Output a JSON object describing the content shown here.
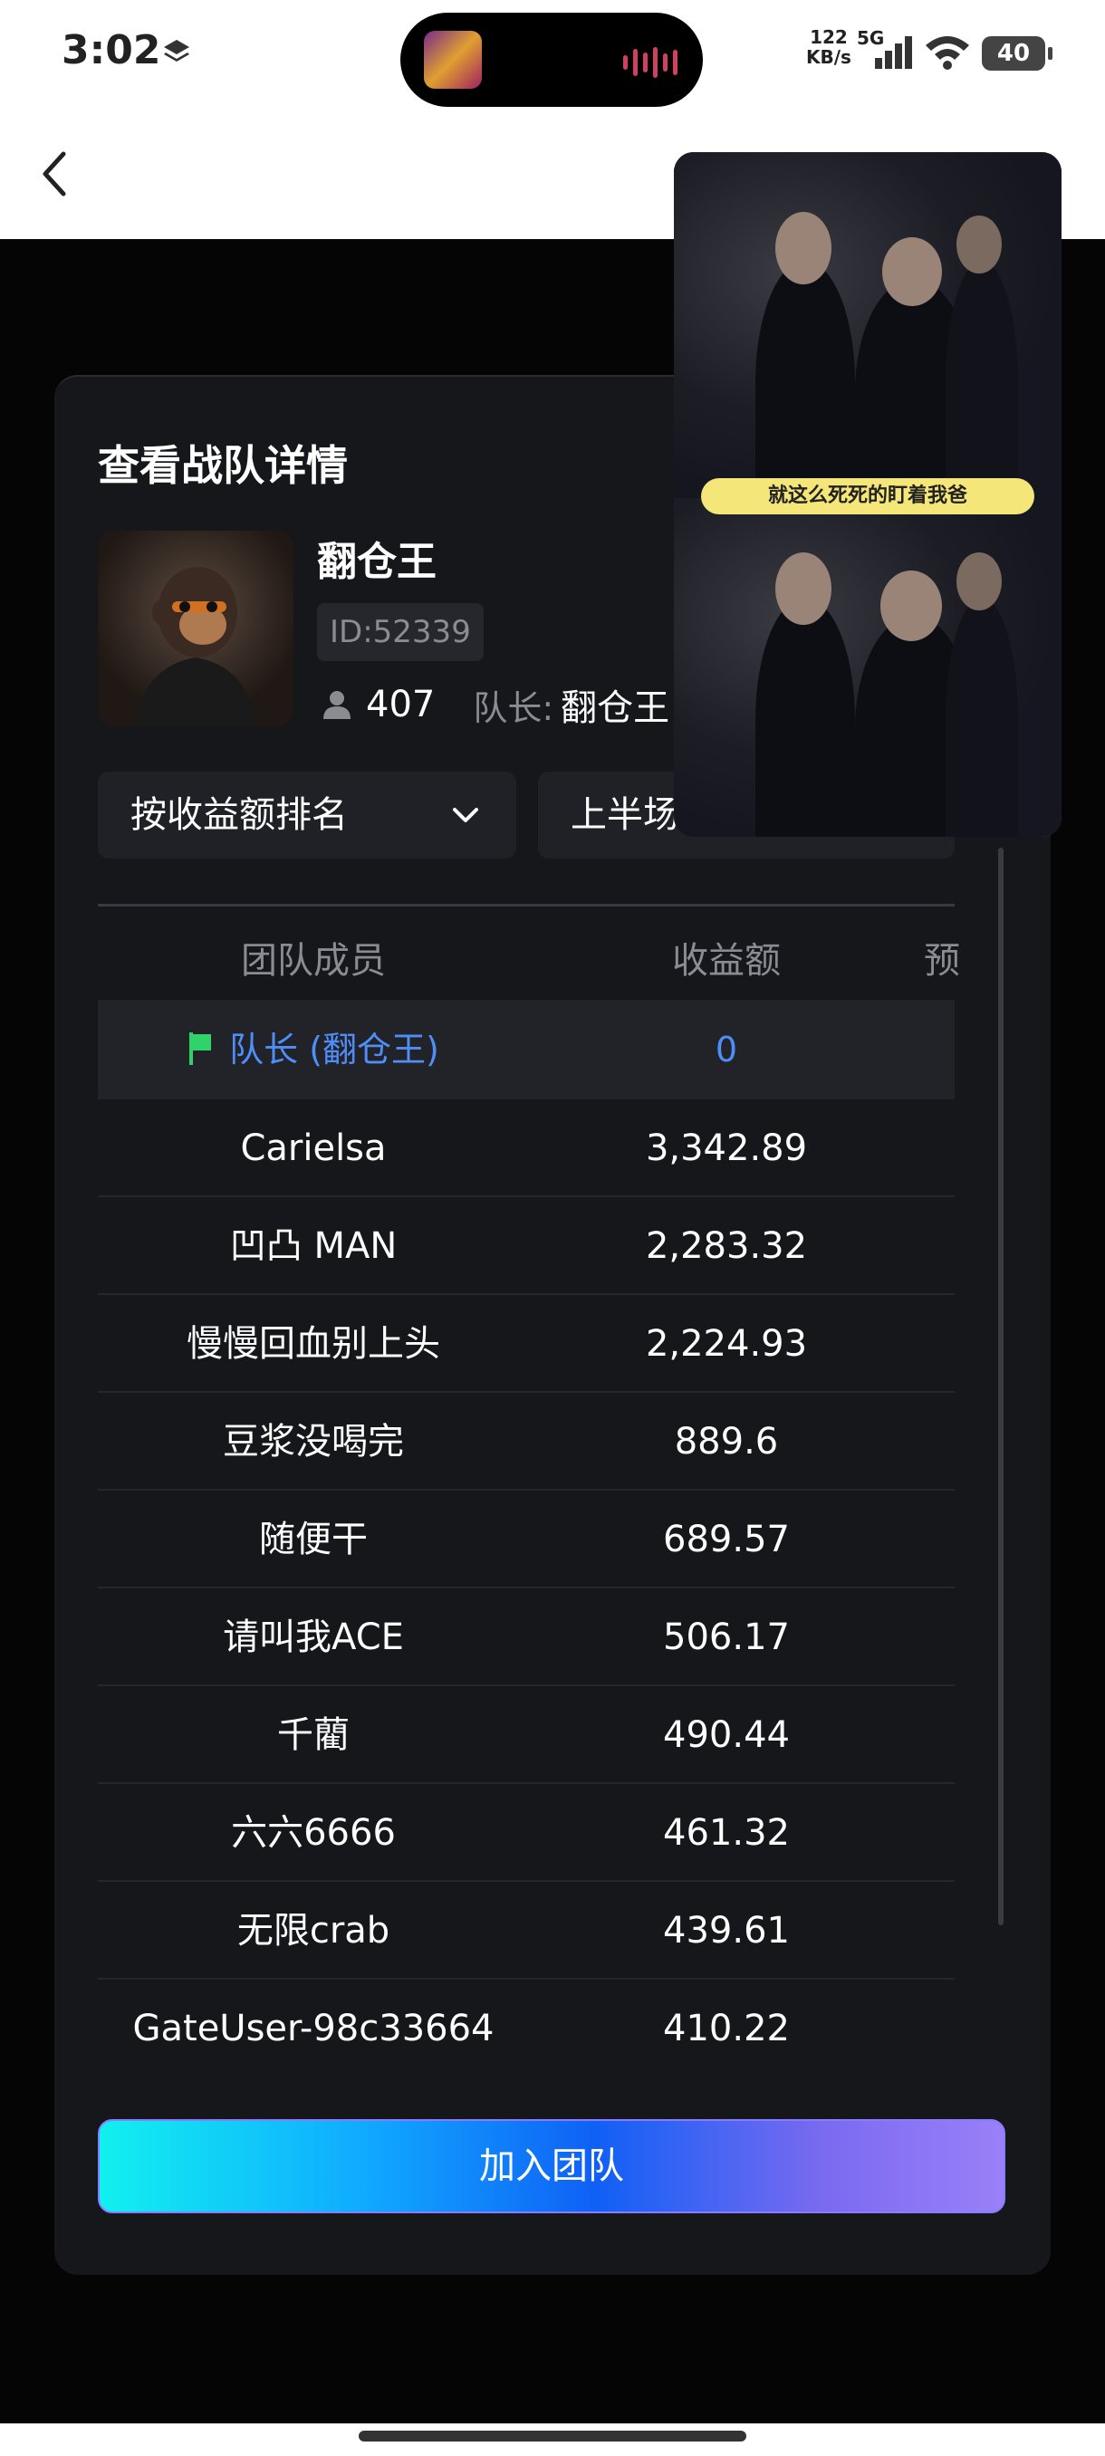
{
  "status_bar": {
    "time": "3:02",
    "net_speed_value": "122",
    "net_speed_unit": "KB/s",
    "network_type": "5G",
    "wifi_level": "6",
    "battery": "40"
  },
  "card": {
    "title": "查看战队详情",
    "team_name": "翻仓王",
    "team_id": "ID:52339",
    "member_count": "407",
    "leader_label": "队长:",
    "leader_name": "翻仓王",
    "sort_select": "按收益额排名",
    "period_select": "上半场",
    "table": {
      "headers": [
        "团队成员",
        "收益额",
        "预"
      ],
      "leader_row": {
        "member": "队长 (翻仓王)",
        "amount": "0"
      },
      "rows": [
        {
          "member": "Carielsa",
          "amount": "3,342.89"
        },
        {
          "member": "凹凸 MAN",
          "amount": "2,283.32"
        },
        {
          "member": "慢慢回血别上头",
          "amount": "2,224.93"
        },
        {
          "member": "豆浆没喝完",
          "amount": "889.6"
        },
        {
          "member": "随便干",
          "amount": "689.57"
        },
        {
          "member": "请叫我ACE",
          "amount": "506.17"
        },
        {
          "member": "千藺",
          "amount": "490.44"
        },
        {
          "member": "六六6666",
          "amount": "461.32"
        },
        {
          "member": "无限crab",
          "amount": "439.61"
        },
        {
          "member": "GateUser-98c33664",
          "amount": "410.22"
        }
      ]
    },
    "join_button": "加入团队"
  },
  "pip_video": {
    "subtitle": "就这么死死的盯着我爸"
  },
  "colors": {
    "accent_blue": "#4f8ef7",
    "flag_green": "#2fd36a",
    "card_bg": "#16171b"
  }
}
